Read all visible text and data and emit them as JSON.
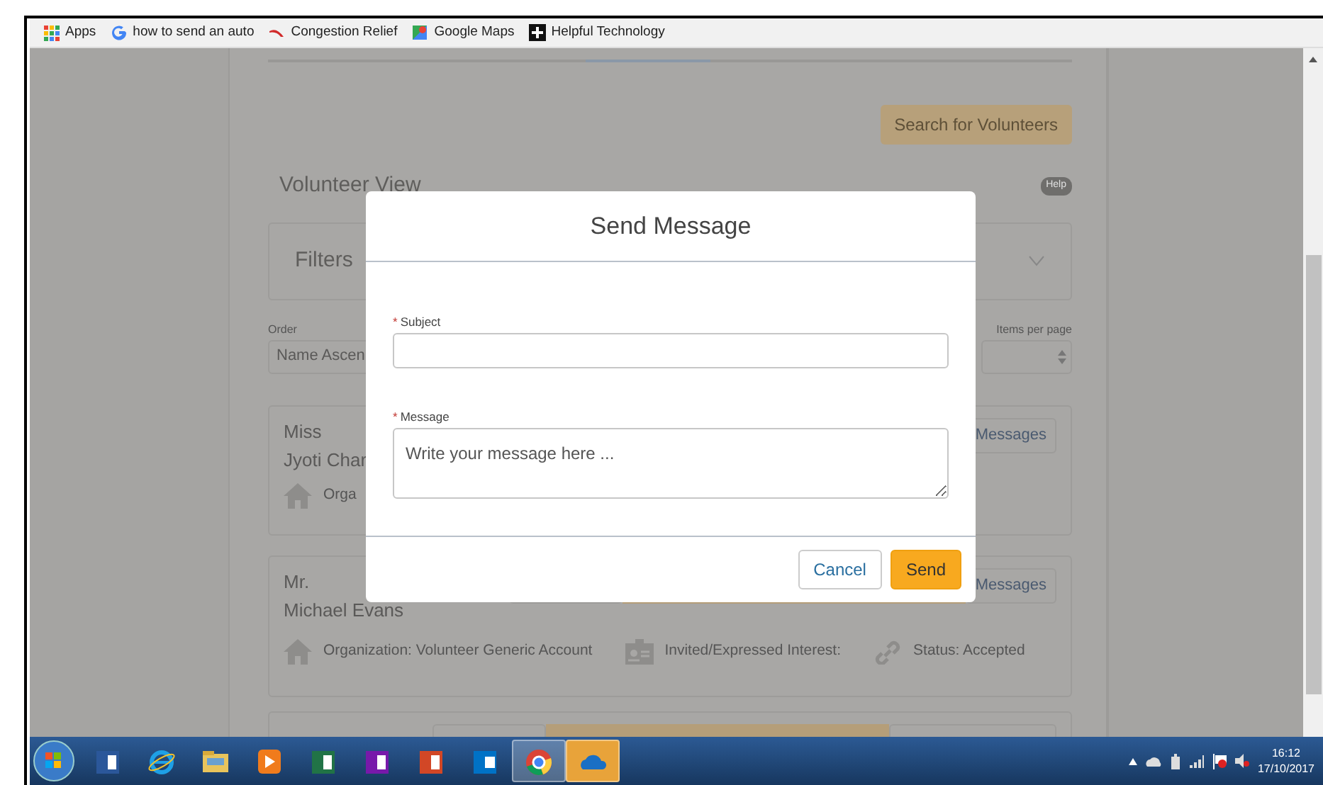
{
  "bookmarks": [
    {
      "label": "Apps",
      "kind": "apps"
    },
    {
      "label": "how to send an auto",
      "kind": "google"
    },
    {
      "label": "Congestion Relief",
      "kind": "swoosh"
    },
    {
      "label": "Google Maps",
      "kind": "maps"
    },
    {
      "label": "Helpful Technology",
      "kind": "plus"
    }
  ],
  "page": {
    "search_button": "Search for Volunteers",
    "section_title": "Volunteer View",
    "help_badge": "Help",
    "filters": {
      "label": "Filters",
      "expanded": false
    },
    "order": {
      "label": "Order",
      "value": "Name Ascen"
    },
    "items_per_page": {
      "label": "Items per page"
    },
    "volunteers": [
      {
        "name_lines": [
          "Miss",
          "Jyoti Char"
        ],
        "messages_button": "Messages",
        "details": [
          {
            "kind": "organization",
            "text": "Orga"
          }
        ]
      },
      {
        "name_lines": [
          "Mr.",
          "Michael Evans"
        ],
        "messages_button": "Messages",
        "details": [
          {
            "kind": "organization",
            "text": "Organization: Volunteer Generic Account"
          },
          {
            "kind": "interest",
            "text": "Invited/Expressed Interest:"
          },
          {
            "kind": "status",
            "text": "Status: Accepted"
          }
        ]
      }
    ]
  },
  "modal": {
    "title": "Send Message",
    "fields": [
      {
        "label": "Subject",
        "required_mark": "*",
        "kind": "input"
      },
      {
        "label": "Message",
        "required_mark": "*",
        "kind": "textarea",
        "placeholder": "Write your message here ..."
      }
    ],
    "buttons": [
      {
        "label": "Cancel",
        "kind": "secondary"
      },
      {
        "label": "Send",
        "kind": "primary"
      }
    ]
  },
  "taskbar": {
    "apps": [
      {
        "kind": "word"
      },
      {
        "kind": "ie"
      },
      {
        "kind": "explorer"
      },
      {
        "kind": "media"
      },
      {
        "kind": "excel"
      },
      {
        "kind": "onenote"
      },
      {
        "kind": "powerpoint"
      },
      {
        "kind": "outlook"
      },
      {
        "kind": "chrome"
      },
      {
        "kind": "onedrive"
      }
    ],
    "time": "16:12",
    "date": "17/10/2017"
  }
}
